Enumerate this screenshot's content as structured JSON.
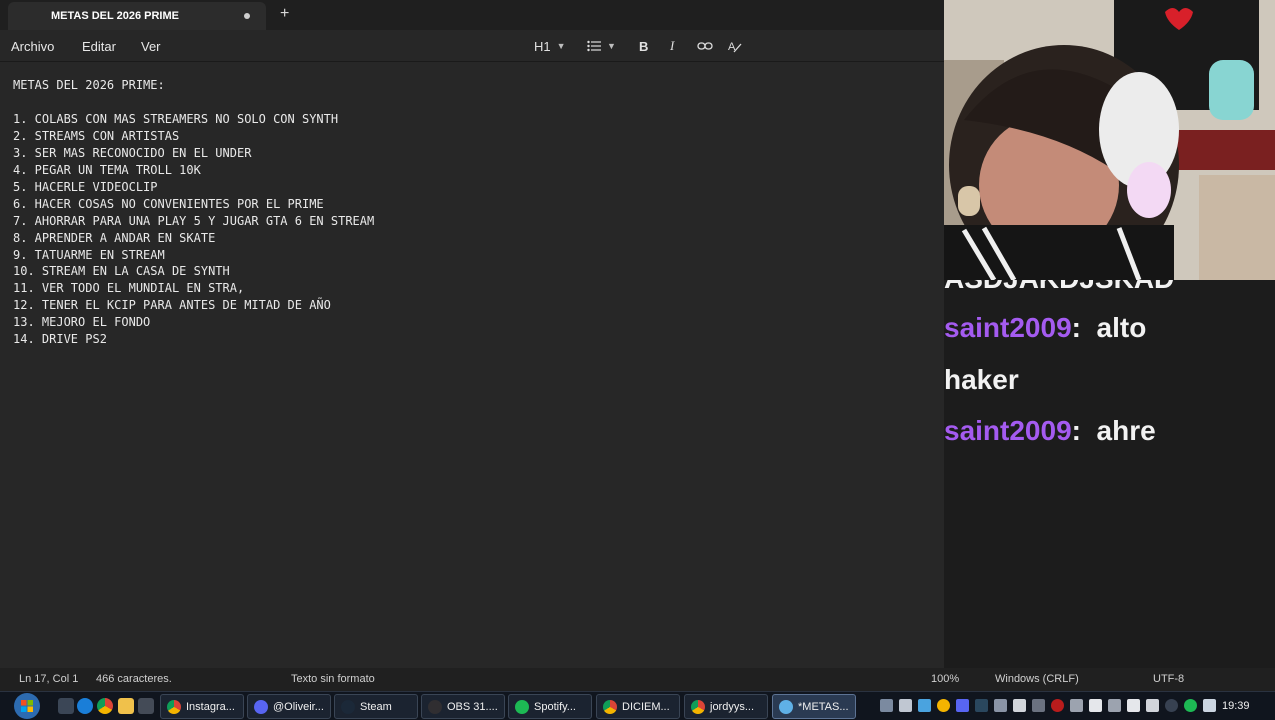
{
  "window": {
    "tab_title": "METAS DEL 2026 PRIME",
    "new_tab_symbol": "+"
  },
  "menu": {
    "file": "Archivo",
    "edit": "Editar",
    "view": "Ver"
  },
  "toolbar": {
    "heading": "H1",
    "bold": "B",
    "italic": "I"
  },
  "document": {
    "lines": [
      "METAS DEL 2026 PRIME:",
      "",
      "1. COLABS CON MAS STREAMERS NO SOLO CON SYNTH",
      "2. STREAMS CON ARTISTAS",
      "3. SER MAS RECONOCIDO EN EL UNDER",
      "4. PEGAR UN TEMA TROLL 10K",
      "5. HACERLE VIDEOCLIP",
      "6. HACER COSAS NO CONVENIENTES POR EL PRIME",
      "7. AHORRAR PARA UNA PLAY 5 Y JUGAR GTA 6 EN STREAM",
      "8. APRENDER A ANDAR EN SKATE",
      "9. TATUARME EN STREAM",
      "10. STREAM EN LA CASA DE SYNTH",
      "11. VER TODO EL MUNDIAL EN STRA,",
      "12. TENER EL KCIP PARA ANTES DE MITAD DE AÑO",
      "13. MEJORO EL FONDO",
      "14. DRIVE PS2"
    ]
  },
  "status": {
    "position": "Ln 17, Col 1",
    "chars": "466 caracteres.",
    "format": "Texto sin formato",
    "zoom": "100%",
    "line_ending": "Windows (CRLF)",
    "encoding": "UTF-8"
  },
  "chat": {
    "partial_top": "ASDJAKDJSKAD",
    "messages": [
      {
        "user": "saint2009",
        "text": "alto"
      },
      {
        "user": "",
        "text": "haker"
      },
      {
        "user": "saint2009",
        "text": "ahre"
      }
    ],
    "user_color": "#a45bf0"
  },
  "taskbar": {
    "tasks": [
      {
        "label": "Instagra...",
        "icon": "chrome-icon"
      },
      {
        "label": "@Oliveir...",
        "icon": "discord-icon"
      },
      {
        "label": "Steam",
        "icon": "steam-icon"
      },
      {
        "label": "OBS 31....",
        "icon": "obs-icon"
      },
      {
        "label": "Spotify...",
        "icon": "spotify-icon"
      },
      {
        "label": "DICIEM...",
        "icon": "chrome-icon"
      },
      {
        "label": "jordyys...",
        "icon": "chrome-icon"
      },
      {
        "label": "*METAS...",
        "icon": "notepad-icon"
      }
    ],
    "clock": "19:39"
  }
}
